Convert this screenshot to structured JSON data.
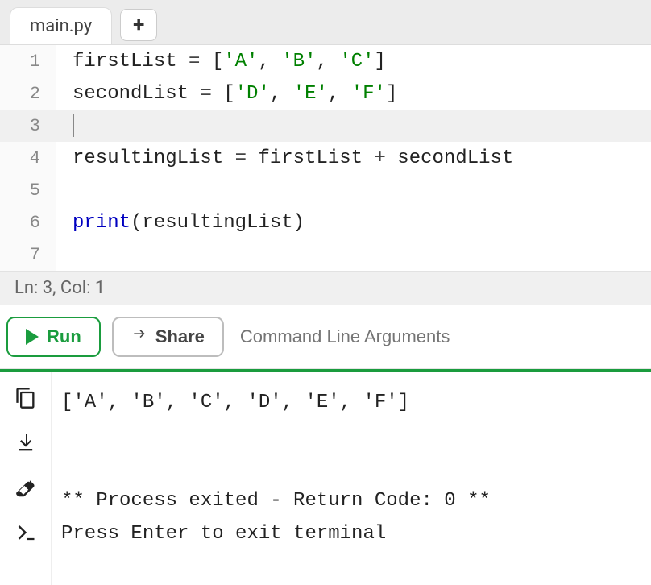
{
  "tabs": {
    "active": "main.py"
  },
  "editor": {
    "lines": [
      {
        "n": 1,
        "tokens": [
          {
            "t": "firstList ",
            "c": "plain"
          },
          {
            "t": "=",
            "c": "op"
          },
          {
            "t": " [",
            "c": "plain"
          },
          {
            "t": "'A'",
            "c": "str"
          },
          {
            "t": ", ",
            "c": "plain"
          },
          {
            "t": "'B'",
            "c": "str"
          },
          {
            "t": ", ",
            "c": "plain"
          },
          {
            "t": "'C'",
            "c": "str"
          },
          {
            "t": "]",
            "c": "plain"
          }
        ]
      },
      {
        "n": 2,
        "tokens": [
          {
            "t": "secondList ",
            "c": "plain"
          },
          {
            "t": "=",
            "c": "op"
          },
          {
            "t": " [",
            "c": "plain"
          },
          {
            "t": "'D'",
            "c": "str"
          },
          {
            "t": ", ",
            "c": "plain"
          },
          {
            "t": "'E'",
            "c": "str"
          },
          {
            "t": ", ",
            "c": "plain"
          },
          {
            "t": "'F'",
            "c": "str"
          },
          {
            "t": "]",
            "c": "plain"
          }
        ]
      },
      {
        "n": 3,
        "current": true,
        "tokens": []
      },
      {
        "n": 4,
        "tokens": [
          {
            "t": "resultingList ",
            "c": "plain"
          },
          {
            "t": "=",
            "c": "op"
          },
          {
            "t": " firstList ",
            "c": "plain"
          },
          {
            "t": "+",
            "c": "op"
          },
          {
            "t": " secondList",
            "c": "plain"
          }
        ]
      },
      {
        "n": 5,
        "tokens": []
      },
      {
        "n": 6,
        "tokens": [
          {
            "t": "print",
            "c": "builtin"
          },
          {
            "t": "(resultingList)",
            "c": "plain"
          }
        ]
      },
      {
        "n": 7,
        "tokens": []
      }
    ],
    "status": "Ln: 3,  Col: 1"
  },
  "toolbar": {
    "run_label": "Run",
    "share_label": "Share",
    "cli_placeholder": "Command Line Arguments"
  },
  "terminal": {
    "lines": [
      "['A', 'B', 'C', 'D', 'E', 'F']",
      "",
      "",
      "** Process exited - Return Code: 0 **",
      "Press Enter to exit terminal"
    ]
  }
}
